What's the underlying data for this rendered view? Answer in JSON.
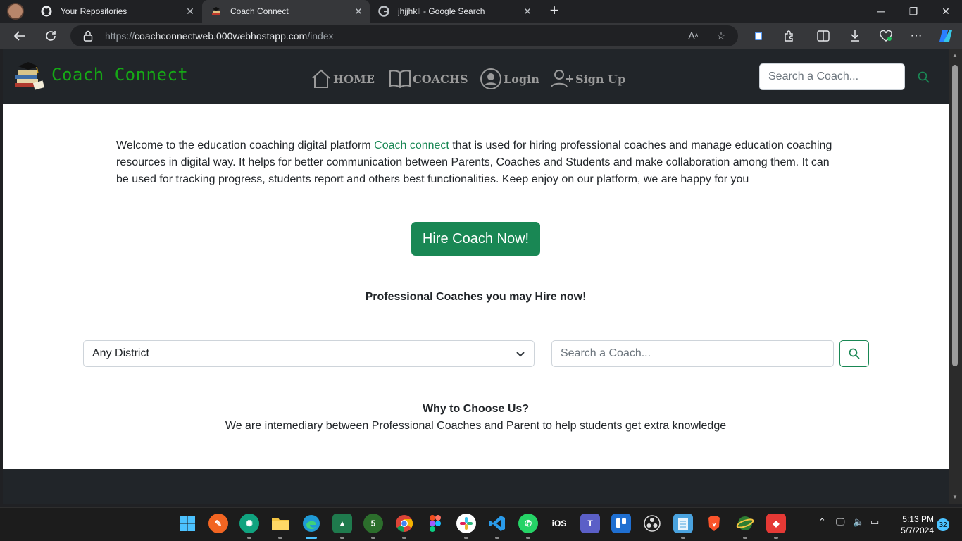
{
  "browser": {
    "tabs": [
      {
        "title": "Your Repositories",
        "favicon": "github-icon"
      },
      {
        "title": "Coach Connect",
        "favicon": "coach-connect-favicon"
      },
      {
        "title": "jhjjhkll - Google Search",
        "favicon": "google-icon"
      }
    ],
    "url_prefix": "https://",
    "url_host": "coachconnectweb.000webhostapp.com",
    "url_path": "/index"
  },
  "site": {
    "brand": "Coach Connect",
    "nav": {
      "home": "HOME",
      "coachs": "COACHS",
      "login": "Login",
      "signup": "Sign Up"
    },
    "nav_search_placeholder": "Search a Coach..."
  },
  "main": {
    "intro_before": "Welcome to the education coaching digital platform ",
    "intro_link": "Coach connect",
    "intro_after": " that is used for hiring professional coaches and manage education coaching resources in digital way. It helps for better communication between Parents, Coaches and Students and make collaboration among them. It can be used for tracking progress, students report and others best functionalities. Keep enjoy on our platform, we are happy for you",
    "hire_button": "Hire Coach Now!",
    "coaches_heading": "Professional Coaches you may Hire now!",
    "district_selected": "Any District",
    "coach_search_placeholder": "Search a Coach...",
    "why_heading": "Why to Choose Us?",
    "why_text": "We are intemediary between Professional Coaches and Parent to help students get extra knowledge"
  },
  "taskbar": {
    "time": "5:13 PM",
    "date": "5/7/2024",
    "notifications": "32",
    "ios_label": "iOS"
  },
  "colors": {
    "brand_green": "#16a816",
    "button_green": "#198754",
    "navbar_dark": "#212529"
  }
}
